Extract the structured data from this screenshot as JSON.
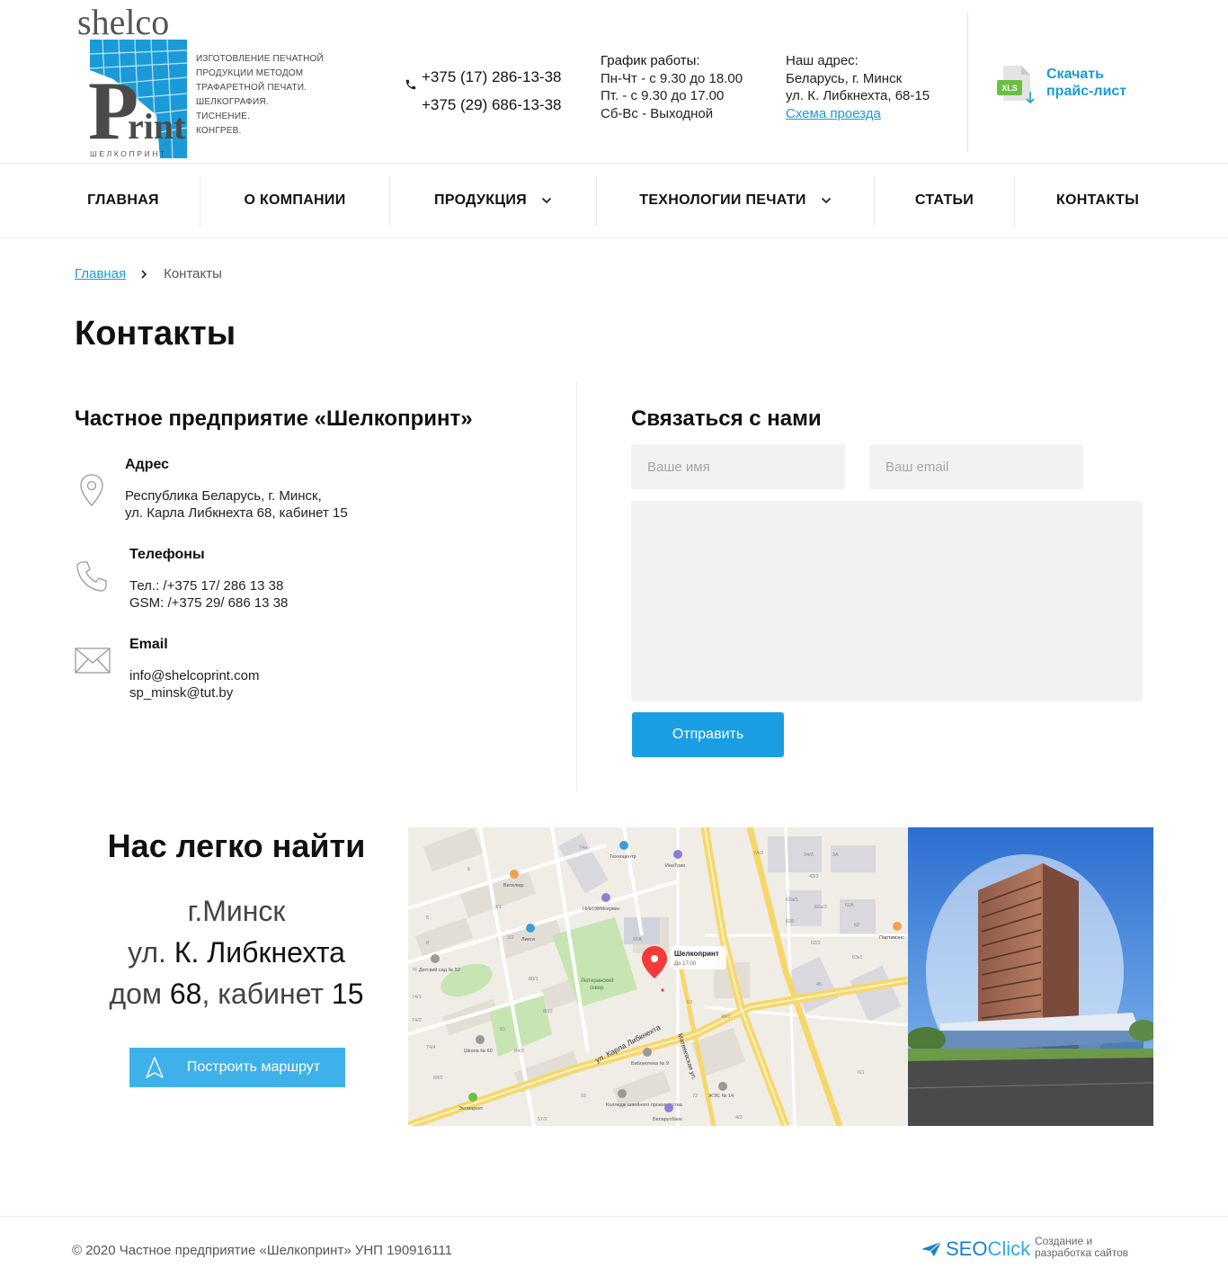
{
  "brand": {
    "logo_top": "shelco",
    "logo_main": "Print",
    "logo_bottom": "ШЕЛКОПРИНТ",
    "tagline": [
      "ИЗГОТОВЛЕНИЕ ПЕЧАТНОЙ",
      "ПРОДУКЦИИ МЕТОДОМ",
      "ТРАФАРЕТНОЙ ПЕЧАТИ.",
      "ШЕЛКОГРАФИЯ.",
      "ТИСНЕНИЕ.",
      "КОНГРЕВ."
    ],
    "accent_color": "#1a9bd7"
  },
  "header": {
    "phones": [
      "+375 (17) 286-13-38",
      "+375 (29) 686-13-38"
    ],
    "schedule": {
      "title": "График работы:",
      "lines": [
        "Пн-Чт - с 9.30 до 18.00",
        "Пт. - с 9.30 до 17.00",
        "Сб-Вс - Выходной"
      ]
    },
    "address": {
      "title": "Наш адрес:",
      "lines": [
        "Беларусь, г. Минск",
        "ул. К. Либкнехта, 68-15"
      ],
      "link": "Схема проезда"
    },
    "price": {
      "icon_label": "XLS",
      "lines": [
        "Скачать",
        "прайс-лист"
      ]
    }
  },
  "nav": [
    {
      "label": "Главная",
      "has_dropdown": false
    },
    {
      "label": "О компании",
      "has_dropdown": false
    },
    {
      "label": "Продукция",
      "has_dropdown": true
    },
    {
      "label": "Технологии печати",
      "has_dropdown": true
    },
    {
      "label": "Статьи",
      "has_dropdown": false
    },
    {
      "label": "Контакты",
      "has_dropdown": false
    }
  ],
  "breadcrumb": {
    "home": "Главная",
    "current": "Контакты"
  },
  "page_title": "Контакты",
  "contacts": {
    "company": "Частное предприятие «Шелкопринт»",
    "address": {
      "title": "Адрес",
      "lines": [
        "Республика Беларусь, г. Минск,",
        "ул. Карла Либкнехта 68, кабинет 15"
      ]
    },
    "phones": {
      "title": "Телефоны",
      "lines": [
        "Тел.: /+375 17/  286 13 38",
        "GSM: /+375 29/ 686 13 38"
      ]
    },
    "email": {
      "title": "Email",
      "lines": [
        "info@shelcoprint.com",
        "sp_minsk@tut.by"
      ]
    }
  },
  "form": {
    "title": "Связаться с нами",
    "name_placeholder": "Ваше имя",
    "email_placeholder": "Ваш email",
    "message_value": "",
    "submit": "Отправить"
  },
  "find_us": {
    "title": "Нас легко найти",
    "city": "г.Минск",
    "street_prefix": "ул.",
    "street": "К. Либкнехта",
    "house_prefix": "дом",
    "house": "68",
    "room_prefix": ", кабинет",
    "room": "15",
    "route_button": "Построить маршрут"
  },
  "map": {
    "pin_label": "Шелкоприн�т",
    "pin_sub": "До 17:00",
    "street_label": "ул. Карла Либкнехта",
    "street2_label": "Матвеевская ул.",
    "square_label": [
      "Лютеранский",
      "сквер"
    ],
    "square_sub": "Лютеранск. сквер",
    "poi": [
      "Вителюр",
      "НИИЭВМсервис",
      "ИнаТрио",
      "Техноцентр",
      "Лиеги",
      "Партимэнс",
      "Детский сад № 52",
      "Школа № 60",
      "Библиотека № 9",
      "Колледж швейного производства",
      "ЖЭС № 14",
      "Беларусбанк",
      "Экомаркет"
    ],
    "numbers": [
      "6",
      "3/1",
      "3/2",
      "5",
      "8",
      "76",
      "74/1",
      "74/2",
      "74/4",
      "74а",
      "82",
      "80/1",
      "80/2",
      "84/2",
      "84/3",
      "55",
      "57/2",
      "63",
      "66А",
      "45",
      "49/1",
      "4/2",
      "62/2",
      "62",
      "62А",
      "62Б",
      "63к1",
      "6/1",
      "3А",
      "7А/2",
      "34/3",
      "43/2",
      "62а/1",
      "62а/2",
      "72"
    ]
  },
  "footer": {
    "copyright": "© 2020 Частное предприятие «Шелкопринт» УНП 190916111",
    "dev_brand_a": "SEO",
    "dev_brand_b": "Click",
    "dev_desc": [
      "Создание и",
      "разработка сайтов"
    ]
  }
}
